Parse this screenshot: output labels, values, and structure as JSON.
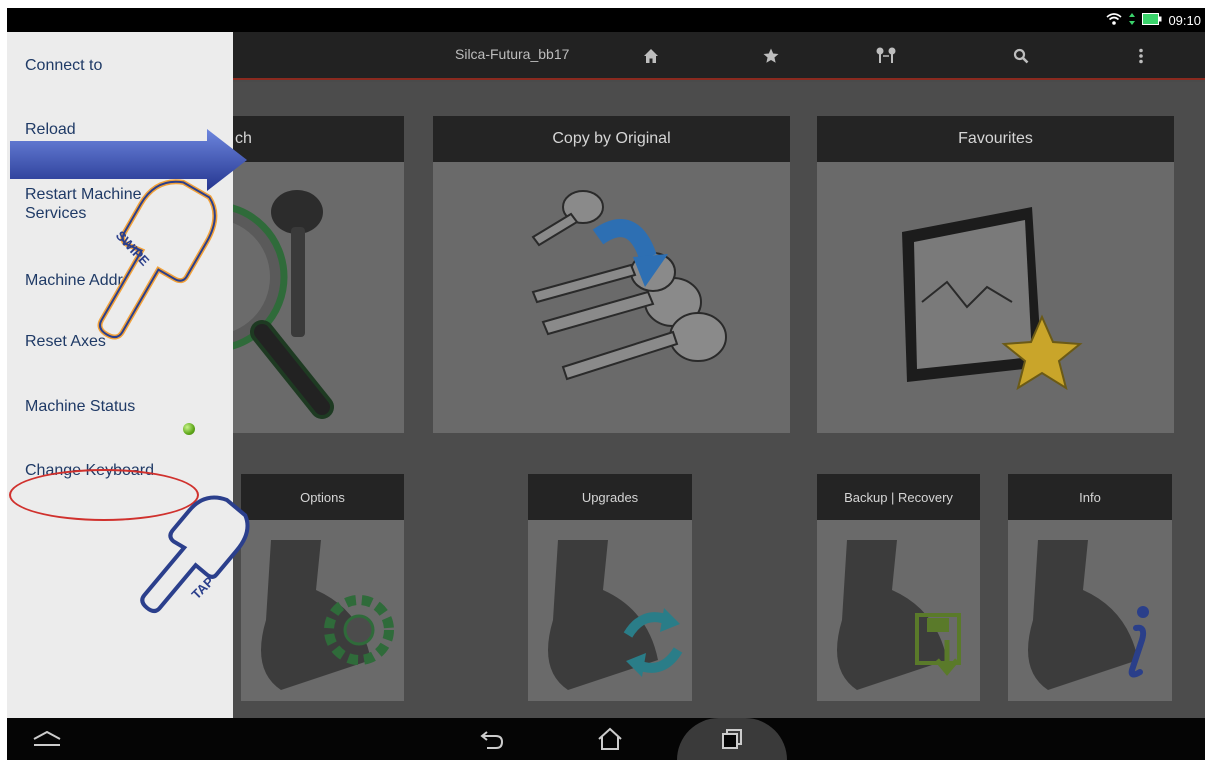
{
  "status_bar": {
    "time": "09:10"
  },
  "action_bar": {
    "title": "Silca-Futura_bb17",
    "icons": [
      "home-icon",
      "star-icon",
      "keys-icon",
      "search-icon",
      "overflow-menu-icon"
    ]
  },
  "drawer": {
    "items": [
      {
        "label": "Connect to"
      },
      {
        "label": "Reload"
      },
      {
        "label": "Restart Machine\nServices"
      },
      {
        "label": "Machine Address"
      },
      {
        "label": "Reset Axes"
      },
      {
        "label": "Machine Status"
      },
      {
        "label": "Change Keyboard"
      }
    ],
    "machine_status_color": "#5fa71a"
  },
  "tiles": {
    "search": "ch",
    "copy_by_original": "Copy by Original",
    "favourites": "Favourites",
    "options": "Options",
    "upgrades": "Upgrades",
    "backup_recovery": "Backup | Recovery",
    "info": "Info"
  },
  "annotations": {
    "swipe_label": "SWIPE",
    "tap_label": "TAP",
    "highlight_color": "#d0312d",
    "arrow_color": "#3b56b8",
    "hand_outline_color": "#f2a23a"
  },
  "nav_bar": {
    "icons": [
      "collapse-icon",
      "back-icon",
      "home-icon",
      "recents-icon"
    ]
  }
}
